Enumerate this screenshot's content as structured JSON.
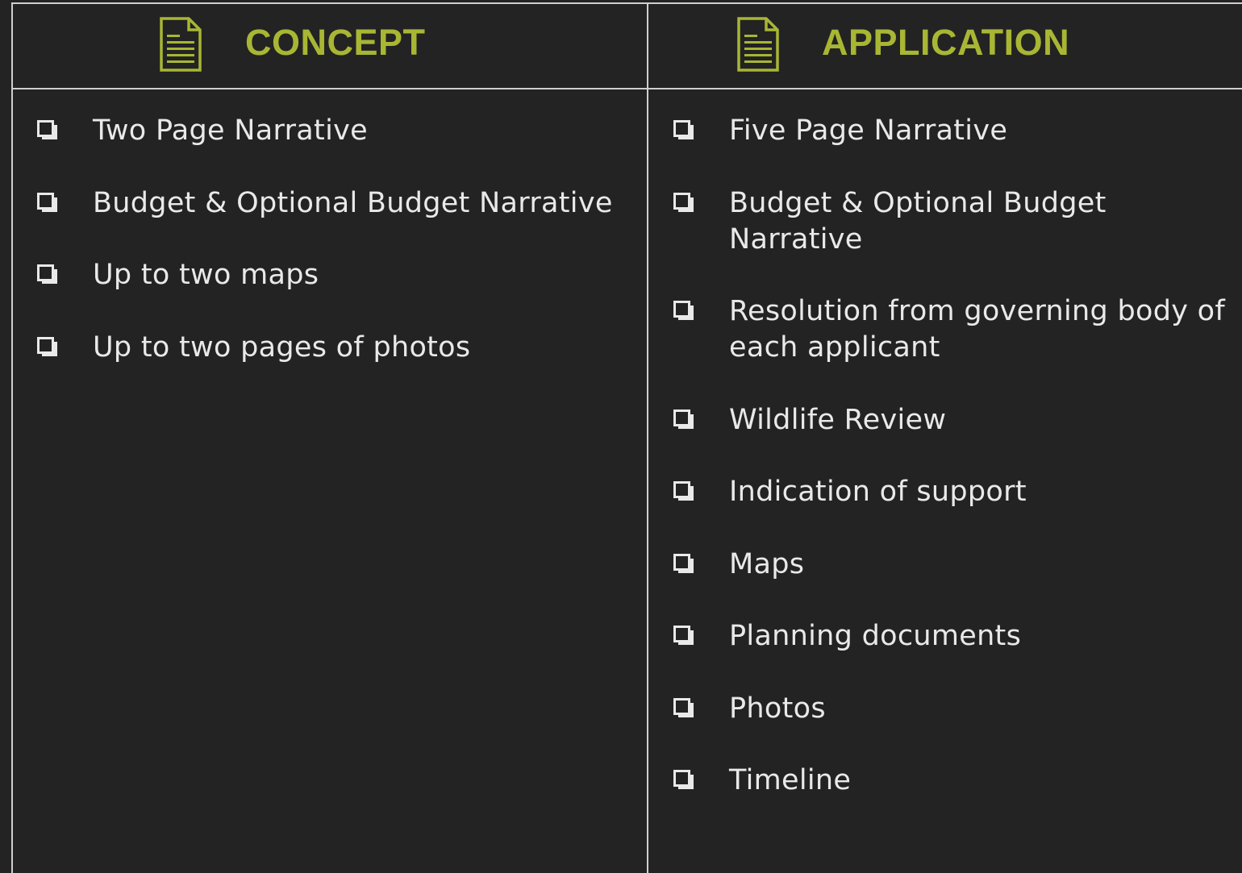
{
  "colors": {
    "background": "#232323",
    "accent": "#a8b634",
    "text": "#e9e9e9",
    "border": "#cfcfcf"
  },
  "columns": {
    "concept": {
      "title": "CONCEPT",
      "icon": "document-icon",
      "items": [
        "Two Page Narrative",
        "Budget & Optional Budget Narrative",
        "Up to two maps",
        "Up to two pages of photos"
      ]
    },
    "application": {
      "title": "APPLICATION",
      "icon": "document-icon",
      "items": [
        "Five Page Narrative",
        "Budget & Optional Budget Narrative",
        "Resolution from governing body of each applicant",
        "Wildlife Review",
        "Indication of support",
        "Maps",
        "Planning documents",
        "Photos",
        "Timeline"
      ]
    }
  }
}
